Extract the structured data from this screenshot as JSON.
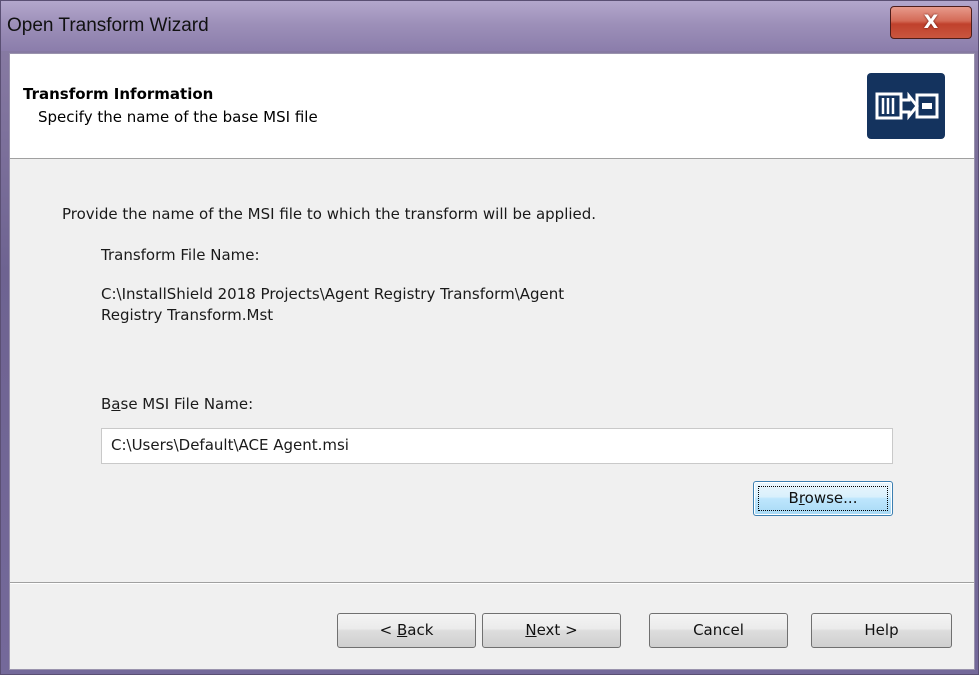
{
  "window": {
    "title": "Open Transform Wizard",
    "close_glyph": "X"
  },
  "header": {
    "title": "Transform Information",
    "subtitle": "Specify the name of the base MSI file",
    "icon": "transform-icon"
  },
  "body": {
    "instruction": "Provide the name of the MSI file to which the transform will be applied.",
    "transform_label": "Transform File Name:",
    "transform_path_line1": "C:\\InstallShield 2018 Projects\\Agent Registry Transform\\Agent",
    "transform_path_line2": "Registry Transform.Mst",
    "base_label_pre": "B",
    "base_label_mnemonic": "a",
    "base_label_post": "se MSI File Name:",
    "base_value": "C:\\Users\\Default\\ACE Agent.msi"
  },
  "buttons": {
    "browse_pre": "B",
    "browse_mnemonic": "r",
    "browse_post": "owse...",
    "back_pre": "< ",
    "back_mnemonic": "B",
    "back_post": "ack",
    "next_mnemonic": "N",
    "next_post": "ext >",
    "cancel": "Cancel",
    "help": "Help"
  },
  "colors": {
    "titlebar": "#9d90b9",
    "close_button": "#c9563f",
    "icon_background": "#14335e",
    "focused_button": "#bee6fd"
  }
}
